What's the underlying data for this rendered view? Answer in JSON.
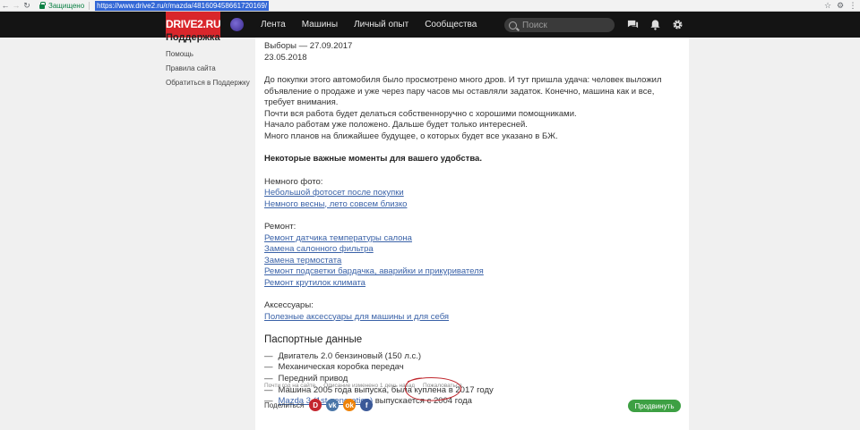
{
  "browser": {
    "secure_label": "Защищено",
    "url": "https://www.drive2.ru/r/mazda/481609458661720169/"
  },
  "header": {
    "logo": "DRIVE2.RU",
    "nav": [
      "Лента",
      "Машины",
      "Личный опыт",
      "Сообщества"
    ],
    "search_placeholder": "Поиск"
  },
  "sidebar": {
    "title": "Поддержка",
    "links": [
      "Помощь",
      "Правила сайта",
      "Обратиться в Поддержку"
    ]
  },
  "article": {
    "dates": [
      "Выборы — 27.09.2017",
      "23.05.2018"
    ],
    "intro": "До покупки этого автомобиля было просмотрено много дров. И тут пришла удача: человек выложил объявление о продаже и уже через пару часов мы оставляли задаток. Конечно, машина как и все, требует внимания.",
    "lines": [
      "Почти вся работа будет делаться собственноручно с хорошими помощниками.",
      "Начало работам уже положено. Дальше будет только интересней.",
      "Много планов на ближайшее будущее, о которых будет все указано в БЖ."
    ],
    "important": "Некоторые важные моменты для вашего удобства.",
    "photo_label": "Немного фото:",
    "photo_links": [
      "Небольшой фотосет после покупки",
      "Немного весны, лето совсем близко"
    ],
    "repair_label": "Ремонт:",
    "repair_links": [
      "Ремонт датчика температуры салона",
      "Замена салонного фильтра",
      "Замена термостата",
      "Ремонт подсветки бардачка, аварийки и прикуривателя",
      "Ремонт крутилок климата"
    ],
    "acc_label": "Аксессуары:",
    "acc_links": [
      "Полезные аксессуары для машины и для себя"
    ],
    "passport_title": "Паспортные данные",
    "dash": "—",
    "passport": [
      "Двигатель 2.0 бензиновый (150 л.с.)",
      "Механическая коробка передач",
      "Передний привод",
      "Машина 2005 года выпуска, была куплена в 2017 году"
    ],
    "model_link": "Mazda 3 (1st generation)",
    "model_suffix": " выпускается с 2004 года"
  },
  "meta": {
    "on_site": "Почти год на сайте",
    "edited": "Описание изменено 1 день назад",
    "complain": "Пожаловаться"
  },
  "share": {
    "label": "Поделиться",
    "icons": [
      {
        "name": "drive2-share-icon",
        "glyph": "D",
        "color": "#c4262e"
      },
      {
        "name": "vk-share-icon",
        "glyph": "vk",
        "color": "#4a76a8"
      },
      {
        "name": "ok-share-icon",
        "glyph": "ok",
        "color": "#ee8208"
      },
      {
        "name": "facebook-share-icon",
        "glyph": "f",
        "color": "#3b5998"
      }
    ]
  },
  "promote_label": "Продвинуть",
  "colors": {
    "accent_red": "#d9262b",
    "link_blue": "#3a62a8",
    "promote_green": "#3da043",
    "annotation_red": "#c0282e"
  }
}
